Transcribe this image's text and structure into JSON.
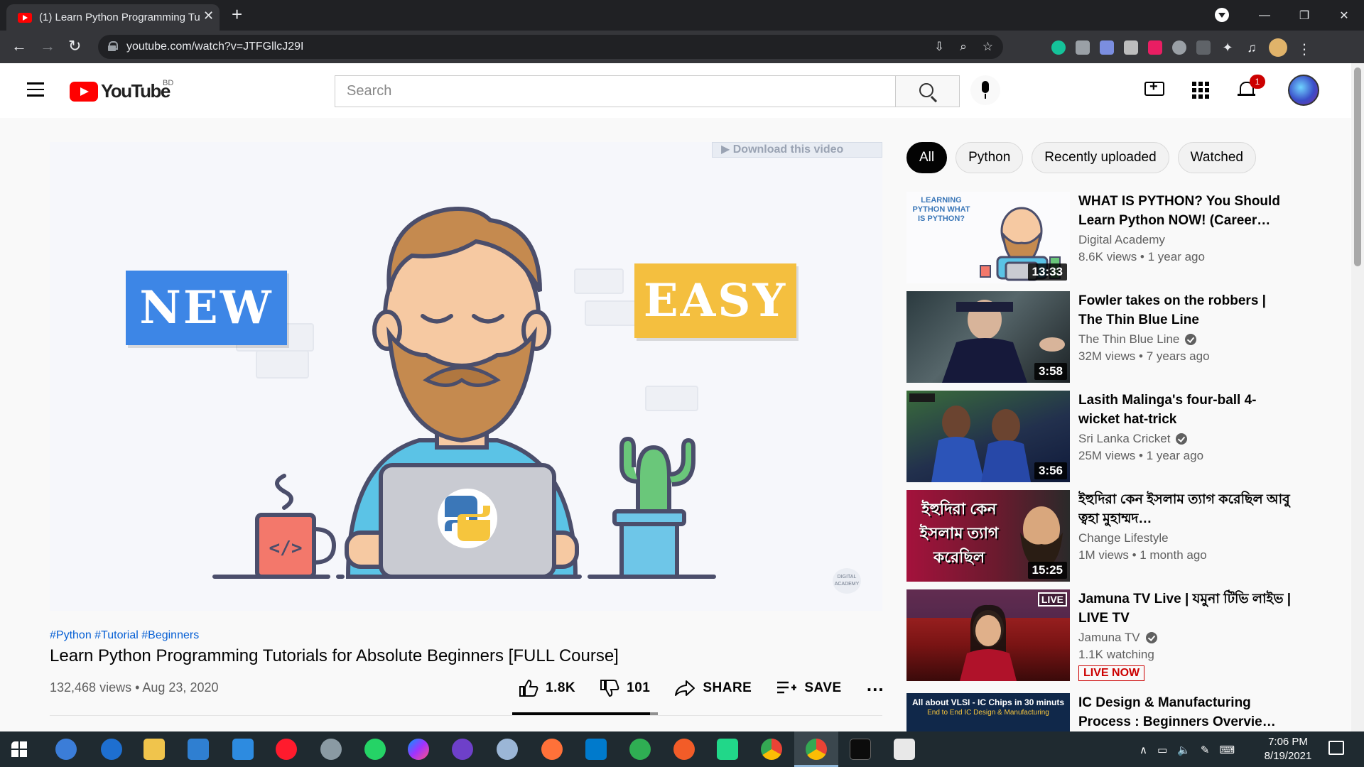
{
  "browser": {
    "tab_title": "(1) Learn Python Programming Tu",
    "new_tab_glyph": "+",
    "close_glyph": "✕",
    "window_controls": [
      "—",
      "❐",
      "✕"
    ],
    "url": "youtube.com/watch?v=JTFGllcJ29I"
  },
  "header": {
    "logo_text": "YouTube",
    "country_code": "BD",
    "search_placeholder": "Search",
    "notification_count": "1"
  },
  "player": {
    "download_bar": "▶ Download this video",
    "sign_left": "NEW",
    "sign_right": "EASY",
    "watermark": "DIGITAL ACADEMY",
    "progress": 0.0
  },
  "video": {
    "hashtags": "#Python #Tutorial #Beginners",
    "title": "Learn Python Programming Tutorials for Absolute Beginners [FULL Course]",
    "meta": "132,468 views • Aug 23, 2020",
    "likes": "1.8K",
    "dislikes": "101",
    "share_label": "SHARE",
    "save_label": "SAVE",
    "more_label": "…",
    "like_fraction": 0.947
  },
  "chips": [
    {
      "label": "All",
      "active": true
    },
    {
      "label": "Python",
      "active": false
    },
    {
      "label": "Recently uploaded",
      "active": false
    },
    {
      "label": "Watched",
      "active": false
    }
  ],
  "related": [
    {
      "title": "WHAT IS PYTHON? You Should Learn Python NOW! (Career…",
      "channel": "Digital Academy",
      "verified": false,
      "meta": "8.6K views • 1 year ago",
      "duration": "13:33",
      "thumb_text": "LEARNING PYTHON WHAT IS PYTHON?"
    },
    {
      "title": "Fowler takes on the robbers | The Thin Blue Line",
      "channel": "The Thin Blue Line",
      "verified": true,
      "meta": "32M views • 7 years ago",
      "duration": "3:58"
    },
    {
      "title": "Lasith Malinga's four-ball 4-wicket hat-trick",
      "channel": "Sri Lanka Cricket",
      "verified": true,
      "meta": "25M views • 1 year ago",
      "duration": "3:56"
    },
    {
      "title": "ইহুদিরা কেন ইসলাম ত্যাগ করেছিল আবু ত্বহা মুহাম্মদ…",
      "channel": "Change Lifestyle",
      "verified": false,
      "meta": "1M views • 1 month ago",
      "duration": "15:25",
      "thumb_text": "ইহুদিরা কেন ইসলাম ত্যাগ করেছিল"
    },
    {
      "title": "Jamuna TV Live | যমুনা টিভি লাইভ | LIVE TV",
      "channel": "Jamuna TV",
      "verified": true,
      "meta": "1.1K watching",
      "live_tag": "LIVE",
      "live_now": "LIVE NOW"
    },
    {
      "title": "IC Design & Manufacturing Process : Beginners Overvie…",
      "thumb_text": "All about VLSI - IC Chips in 30 minuts",
      "thumb_subtext": "End to End IC Design & Manufacturing"
    }
  ],
  "taskbar": {
    "time": "7:06 PM",
    "date": "8/19/2021"
  }
}
